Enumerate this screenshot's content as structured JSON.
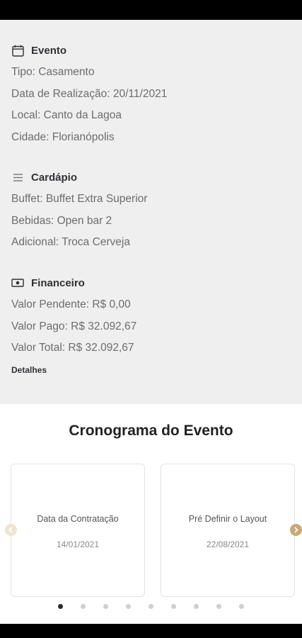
{
  "evento": {
    "title": "Evento",
    "icon": "calendar-icon",
    "lines": [
      "Tipo: Casamento",
      "Data de Realização: 20/11/2021",
      "Local: Canto da Lagoa",
      "Cidade: Florianópolis"
    ]
  },
  "cardapio": {
    "title": "Cardápio",
    "icon": "menu-list-icon",
    "lines": [
      "Buffet: Buffet Extra Superior",
      "Bebidas: Open bar 2",
      "Adicional: Troca Cerveja"
    ]
  },
  "financeiro": {
    "title": "Financeiro",
    "icon": "money-icon",
    "lines": [
      "Valor Pendente: R$ 0,00",
      "Valor Pago: R$ 32.092,67",
      "Valor Total: R$ 32.092,67"
    ],
    "details_label": "Detalhes"
  },
  "cronograma": {
    "title": "Cronograma do Evento",
    "cards": [
      {
        "title": "Data da Contratação",
        "date": "14/01/2021"
      },
      {
        "title": "Pré Definir o Layout",
        "date": "22/08/2021"
      }
    ],
    "page_count": 9,
    "active_page": 1
  },
  "colors": {
    "panel_bg": "#efefef",
    "accent_gold": "#c9a978",
    "arrow_disabled": "#f0e6cf"
  }
}
